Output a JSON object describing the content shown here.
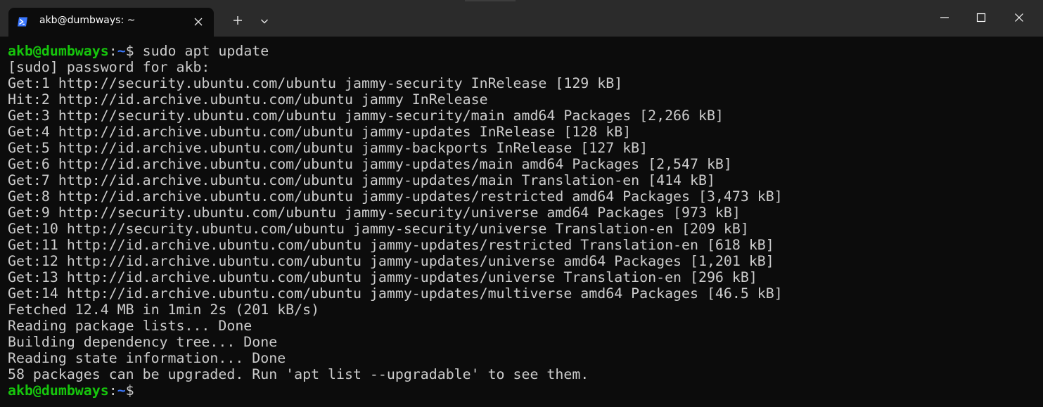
{
  "tab": {
    "title": "akb@dumbways: ~",
    "icon": "powershell-terminal-icon",
    "accent": "#3b78ff"
  },
  "prompt": {
    "user_host": "akb@dumbways",
    "separator": ":",
    "path": "~",
    "symbol": "$ ",
    "user_color": "#16c60c",
    "path_color": "#3b78ff"
  },
  "command": "sudo apt update",
  "output": [
    "[sudo] password for akb:",
    "Get:1 http://security.ubuntu.com/ubuntu jammy-security InRelease [129 kB]",
    "Hit:2 http://id.archive.ubuntu.com/ubuntu jammy InRelease",
    "Get:3 http://security.ubuntu.com/ubuntu jammy-security/main amd64 Packages [2,266 kB]",
    "Get:4 http://id.archive.ubuntu.com/ubuntu jammy-updates InRelease [128 kB]",
    "Get:5 http://id.archive.ubuntu.com/ubuntu jammy-backports InRelease [127 kB]",
    "Get:6 http://id.archive.ubuntu.com/ubuntu jammy-updates/main amd64 Packages [2,547 kB]",
    "Get:7 http://id.archive.ubuntu.com/ubuntu jammy-updates/main Translation-en [414 kB]",
    "Get:8 http://id.archive.ubuntu.com/ubuntu jammy-updates/restricted amd64 Packages [3,473 kB]",
    "Get:9 http://security.ubuntu.com/ubuntu jammy-security/universe amd64 Packages [973 kB]",
    "Get:10 http://security.ubuntu.com/ubuntu jammy-security/universe Translation-en [209 kB]",
    "Get:11 http://id.archive.ubuntu.com/ubuntu jammy-updates/restricted Translation-en [618 kB]",
    "Get:12 http://id.archive.ubuntu.com/ubuntu jammy-updates/universe amd64 Packages [1,201 kB]",
    "Get:13 http://id.archive.ubuntu.com/ubuntu jammy-updates/universe Translation-en [296 kB]",
    "Get:14 http://id.archive.ubuntu.com/ubuntu jammy-updates/multiverse amd64 Packages [46.5 kB]",
    "Fetched 12.4 MB in 1min 2s (201 kB/s)",
    "Reading package lists... Done",
    "Building dependency tree... Done",
    "Reading state information... Done",
    "58 packages can be upgraded. Run 'apt list --upgradable' to see them."
  ],
  "controls": {
    "new_tab_icon": "plus-icon",
    "dropdown_icon": "chevron-down-icon",
    "minimize_icon": "minimize-icon",
    "maximize_icon": "maximize-icon",
    "close_icon": "close-icon"
  }
}
